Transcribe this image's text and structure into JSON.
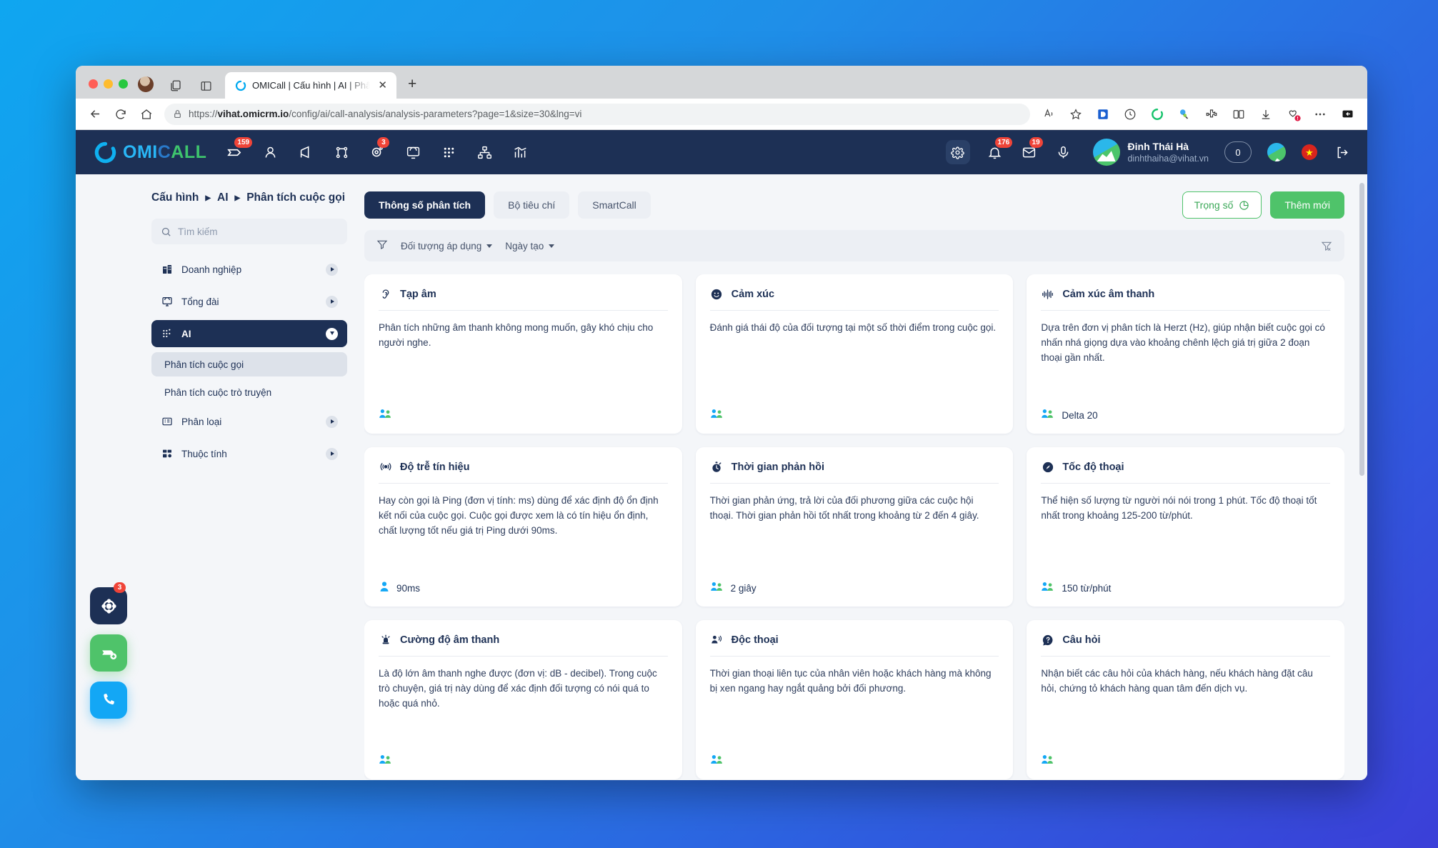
{
  "browser": {
    "tab_title": "OMICall | Cấu hình | AI | Phân tí",
    "url_prefix": "https://",
    "url_domain": "vihat.omicrm.io",
    "url_path": "/config/ai/call-analysis/analysis-parameters?page=1&size=30&lng=vi",
    "new_tab_label": "+",
    "close_tab_label": "✕",
    "icons": {
      "back": "back-arrow-icon",
      "reload": "reload-icon",
      "home": "home-icon",
      "lock": "lock-icon",
      "read_aloud": "read-aloud-icon",
      "favorite": "star-icon",
      "split_screen": "split-screen-icon",
      "downloads": "downloads-icon",
      "collections": "collections-icon",
      "more": "more-options-icon",
      "sidebar": "sidebar-toggle-icon"
    }
  },
  "appbar": {
    "logo": {
      "part1": "OMI",
      "part2": "C",
      "part3": "ALL"
    },
    "nav_items": [
      {
        "name": "tickets-icon",
        "badge": "159"
      },
      {
        "name": "contacts-icon",
        "badge": ""
      },
      {
        "name": "campaign-icon",
        "badge": ""
      },
      {
        "name": "workflow-icon",
        "badge": ""
      },
      {
        "name": "automation-icon",
        "badge": "3"
      },
      {
        "name": "switchboard-icon",
        "badge": ""
      },
      {
        "name": "apps-grid-icon",
        "badge": ""
      },
      {
        "name": "org-chart-icon",
        "badge": ""
      },
      {
        "name": "analytics-icon",
        "badge": ""
      }
    ],
    "settings_icon": "gear-icon",
    "notification_badge": "176",
    "mail_badge": "19",
    "headset_icon": "headset-icon",
    "user_name": "Đinh Thái Hà",
    "user_email": "dinhthaiha@vihat.vn",
    "counter": "0",
    "language_flag": "vn-flag-icon",
    "logout_icon": "logout-icon",
    "colors": {
      "bg": "#1d3055",
      "badge": "#f04438"
    }
  },
  "breadcrumb": {
    "items": [
      "Cấu hình",
      "AI",
      "Phân tích cuộc gọi"
    ]
  },
  "sidebar": {
    "search_placeholder": "Tìm kiếm",
    "search_value": "",
    "items": [
      {
        "label": "Doanh nghiệp",
        "icon": "building-icon",
        "active": false
      },
      {
        "label": "Tổng đài",
        "icon": "switchboard-icon",
        "active": false
      },
      {
        "label": "AI",
        "icon": "ai-dots-icon",
        "active": true
      }
    ],
    "sub_items": [
      {
        "label": "Phân tích cuộc gọi",
        "selected": true
      },
      {
        "label": "Phân tích cuộc trò truyện",
        "selected": false
      }
    ],
    "items_after": [
      {
        "label": "Phân loại",
        "icon": "list-icon",
        "active": false
      },
      {
        "label": "Thuộc tính",
        "icon": "attributes-icon",
        "active": false
      }
    ]
  },
  "toolbar": {
    "tabs": [
      {
        "label": "Thông số phân tích",
        "active": true
      },
      {
        "label": "Bộ tiêu chí",
        "active": false
      },
      {
        "label": "SmartCall",
        "active": false
      }
    ],
    "weight_button": "Trọng số",
    "weight_icon": "pie-chart-icon",
    "add_button": "Thêm mới",
    "accent_green": "#4fc36a",
    "accent_navy": "#1d3055"
  },
  "filters": {
    "funnel_icon": "filter-icon",
    "chips": [
      {
        "label": "Đối tượng áp dụng"
      },
      {
        "label": "Ngày tạo"
      }
    ],
    "clear_icon": "filter-clear-icon"
  },
  "cards": [
    {
      "title": "Tạp âm",
      "icon": "ear-icon",
      "description": "Phân tích những âm thanh không mong muốn, gây khó chịu cho người nghe.",
      "people_icon": "two-people-icon",
      "value": ""
    },
    {
      "title": "Cảm xúc",
      "icon": "smiley-icon",
      "description": "Đánh giá thái độ của đối tượng tại một số thời điểm trong cuộc gọi.",
      "people_icon": "two-people-icon",
      "value": ""
    },
    {
      "title": "Cảm xúc âm thanh",
      "icon": "waveform-icon",
      "description": "Dựa trên đơn vị phân tích là Herzt (Hz), giúp nhận biết cuộc gọi có nhấn nhá giọng dựa vào khoảng chênh lệch giá trị giữa 2 đoạn thoại gần nhất.",
      "people_icon": "two-people-icon",
      "value": "Delta 20"
    },
    {
      "title": "Độ trễ tín hiệu",
      "icon": "signal-icon",
      "description": "Hay còn gọi là Ping (đơn vị tính: ms) dùng để xác định độ ổn định kết nối của cuộc gọi. Cuộc gọi được xem là có tín hiệu ổn định, chất lượng tốt nếu giá trị Ping dưới 90ms.",
      "people_icon": "one-person-icon",
      "value": "90ms"
    },
    {
      "title": "Thời gian phản hồi",
      "icon": "stopwatch-icon",
      "description": "Thời gian phản ứng, trả lời của đối phương giữa các cuộc hội thoại. Thời gian phản hồi tốt nhất trong khoảng từ 2 đến 4 giây.",
      "people_icon": "two-people-icon",
      "value": "2 giây"
    },
    {
      "title": "Tốc độ thoại",
      "icon": "speedometer-icon",
      "description": "Thể hiện số lượng từ người nói nói trong 1 phút. Tốc độ thoại tốt nhất trong khoảng 125-200 từ/phút.",
      "people_icon": "two-people-icon",
      "value": "150 từ/phút"
    },
    {
      "title": "Cường độ âm thanh",
      "icon": "siren-icon",
      "description": "Là độ lớn âm thanh nghe được (đơn vị: dB - decibel). Trong cuộc trò chuyện, giá trị này dùng để xác định đối tượng có nói quá to hoặc quá nhỏ.",
      "people_icon": "two-people-icon",
      "value": ""
    },
    {
      "title": "Độc thoại",
      "icon": "speaking-person-icon",
      "description": "Thời gian thoại liên tục của nhân viên hoặc khách hàng mà không bị xen ngang hay ngắt quảng bởi đối phương.",
      "people_icon": "two-people-icon",
      "value": ""
    },
    {
      "title": "Câu hỏi",
      "icon": "question-bubble-icon",
      "description": "Nhận biết các câu hỏi của khách hàng, nếu khách hàng đặt câu hỏi, chứng tỏ khách hàng quan tâm đến dịch vụ.",
      "people_icon": "two-people-icon",
      "value": ""
    }
  ],
  "fabs": [
    {
      "name": "settings-fab",
      "badge": "3",
      "icon": "gear-wheel-icon"
    },
    {
      "name": "ticket-fab",
      "badge": "",
      "icon": "ticket-add-icon"
    },
    {
      "name": "call-fab",
      "badge": "",
      "icon": "phone-icon"
    }
  ]
}
